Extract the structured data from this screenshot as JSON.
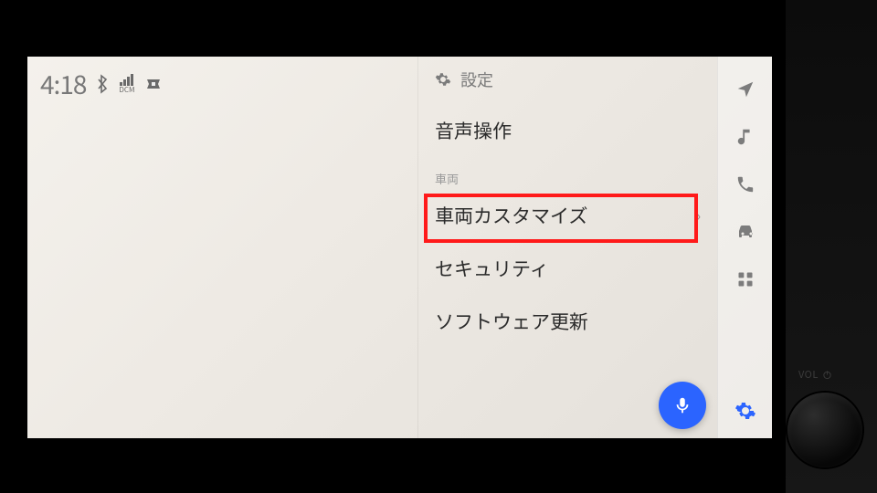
{
  "statusbar": {
    "time": "4:18",
    "dcm_label": "DCM"
  },
  "settings": {
    "header": "設定",
    "items": {
      "voice": "音声操作",
      "vehicle_section": "車両",
      "vehicle_customize": "車両カスタマイズ",
      "security": "セキュリティ",
      "software_update": "ソフトウェア更新"
    }
  },
  "dashboard": {
    "vol_label": "VOL"
  }
}
